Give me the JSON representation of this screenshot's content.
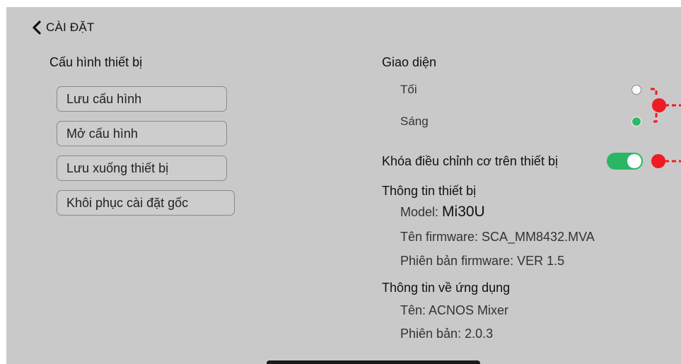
{
  "header": {
    "back_label": "CÀI ĐẶT"
  },
  "config": {
    "title": "Cấu hình thiết bị",
    "buttons": [
      "Lưu cấu hình",
      "Mở cấu hình",
      "Lưu xuống thiết bị",
      "Khôi phục cài đặt gốc"
    ]
  },
  "appearance": {
    "title": "Giao diện",
    "options": [
      {
        "label": "Tối",
        "selected": false
      },
      {
        "label": "Sáng",
        "selected": true
      }
    ]
  },
  "lock": {
    "label": "Khóa điều chỉnh cơ trên thiết bị",
    "enabled": true
  },
  "device_info": {
    "title": "Thông tin thiết bị",
    "model_prefix": "Model: ",
    "model_value": "Mi30U",
    "firmware_name": "Tên firmware: SCA_MM8432.MVA",
    "firmware_version": "Phiên bản firmware: VER 1.5"
  },
  "app_info": {
    "title": "Thông tin về ứng dụng",
    "name": "Tên: ACNOS Mixer",
    "version": "Phiên bản: 2.0.3"
  },
  "colors": {
    "background": "#c9c9c9",
    "accent_green": "#29b765",
    "annotation_red": "#ee1c24"
  },
  "icons": {
    "back": "chevron-left-icon"
  }
}
